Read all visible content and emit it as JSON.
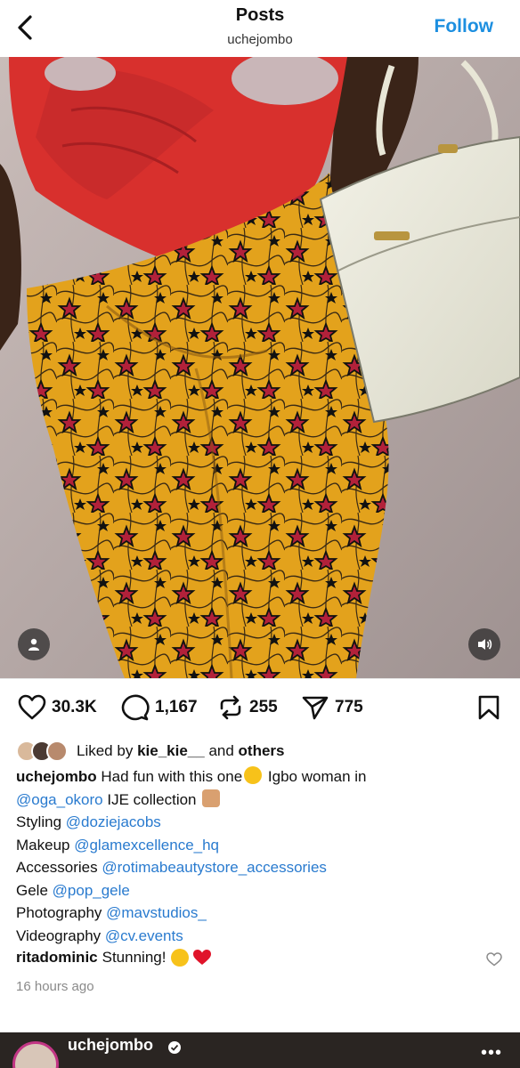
{
  "header": {
    "title": "Posts",
    "username": "uchejombo",
    "follow_label": "Follow"
  },
  "photo": {
    "alt_icons": {
      "tag": "person-icon",
      "audio": "speaker-icon"
    }
  },
  "actions": {
    "likes": "30.3K",
    "comments": "1,167",
    "reposts": "255",
    "shares": "775"
  },
  "liked_by": {
    "prefix": "Liked by",
    "user": "kie_kie__",
    "middle": "and",
    "others": "others"
  },
  "caption": {
    "username": "uchejombo",
    "text_1": "Had fun with this one",
    "text_2": "Igbo woman in",
    "mention_brand": "@oga_okoro",
    "text_3": "IJE collection",
    "lines": [
      {
        "label": "Styling",
        "mention": "@doziejacobs"
      },
      {
        "label": "Makeup",
        "mention": "@glamexcellence_hq"
      },
      {
        "label": "Accessories",
        "mention": "@rotimabeautystore_accessories"
      },
      {
        "label": "Gele",
        "mention": "@pop_gele"
      },
      {
        "label": "Photography",
        "mention": "@mavstudios_"
      },
      {
        "label": "Videography",
        "mention": "@cv.events"
      }
    ]
  },
  "comment": {
    "username": "ritadominic",
    "text": "Stunning!"
  },
  "timestamp": "16 hours ago",
  "next_post": {
    "username": "uchejombo",
    "more": "•••"
  },
  "colors": {
    "link": "#2a7bcf",
    "follow": "#1d8fe0",
    "skirt": "#e3a21c",
    "top": "#d8302d"
  }
}
